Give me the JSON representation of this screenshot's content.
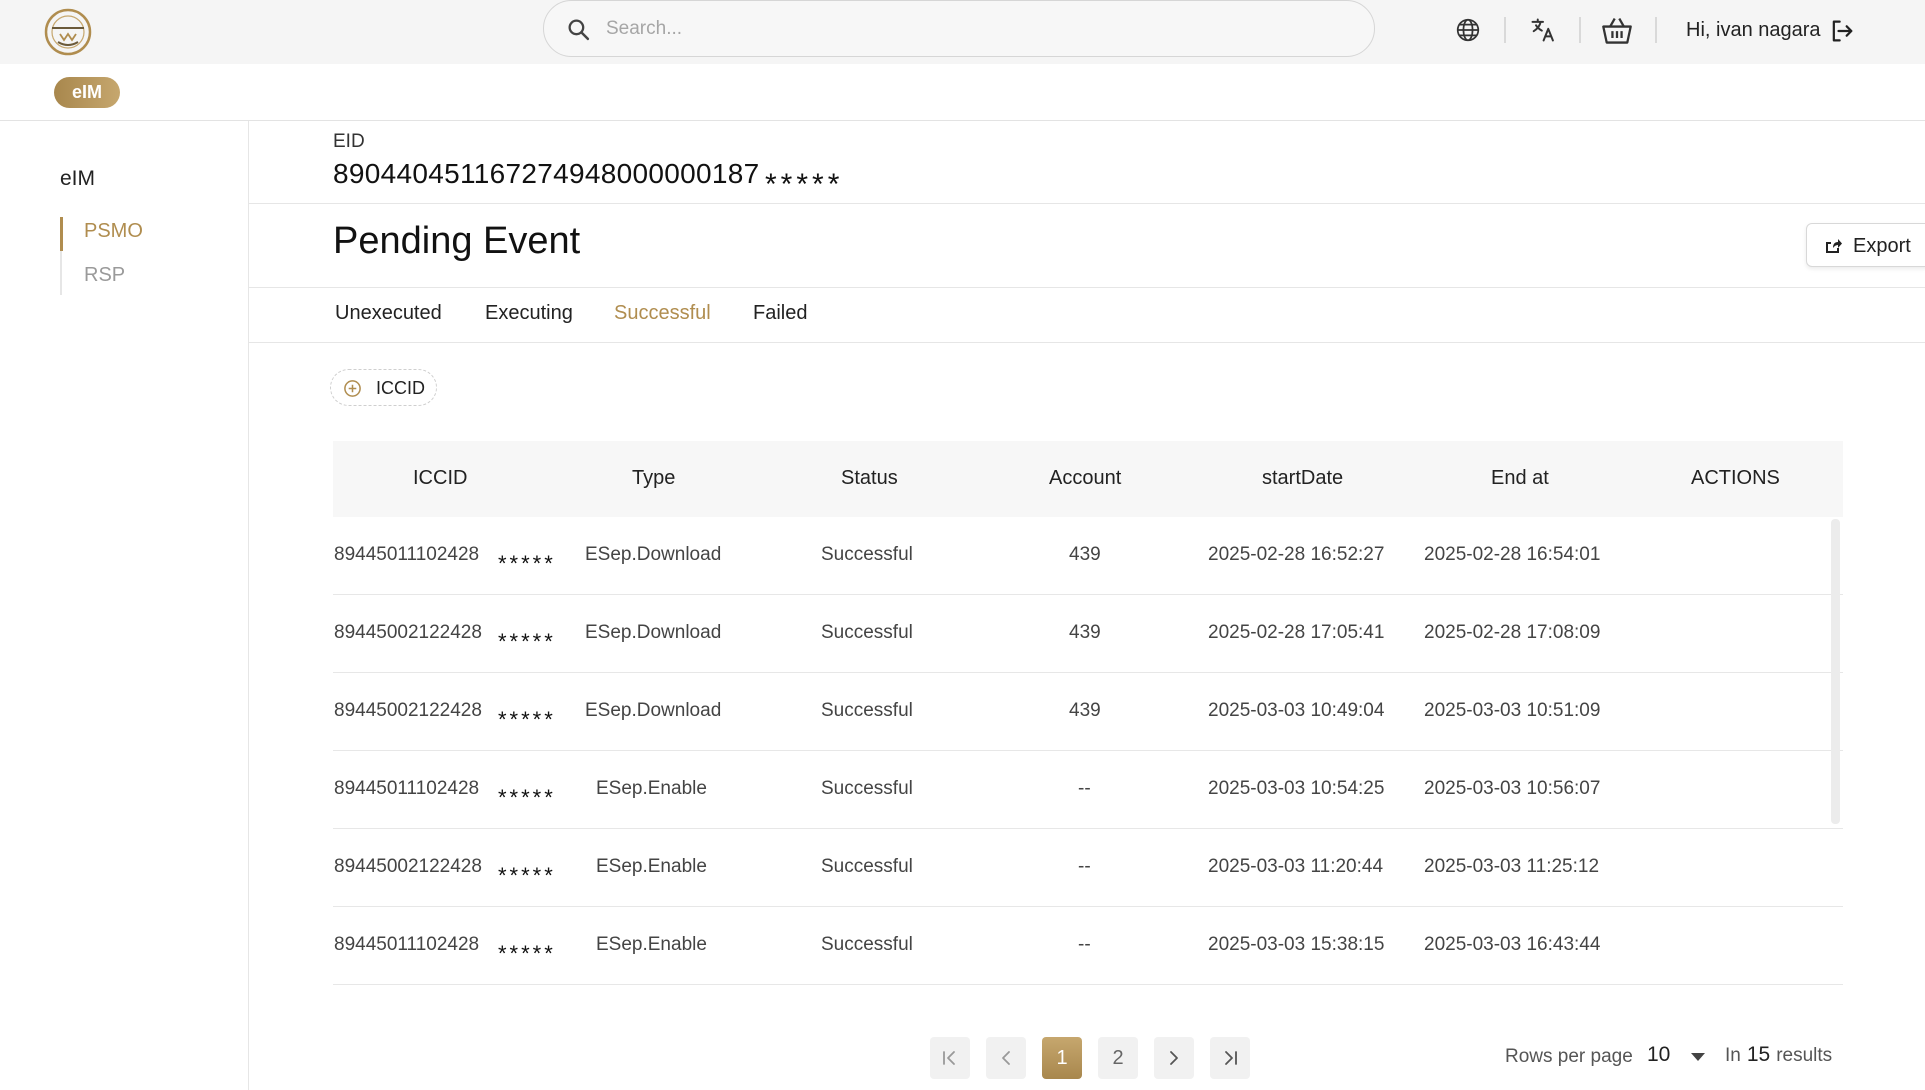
{
  "header": {
    "search_placeholder": "Search...",
    "greeting": "Hi, ivan nagara",
    "icons": [
      "globe-icon",
      "translate-icon",
      "basket-icon",
      "logout-icon"
    ]
  },
  "subbar": {
    "pill_label": "eIM"
  },
  "sidebar": {
    "title": "eIM",
    "items": [
      {
        "label": "PSMO",
        "active": true
      },
      {
        "label": "RSP",
        "active": false
      }
    ]
  },
  "main": {
    "eid_label": "EID",
    "eid_value": "890440451167274948000000187",
    "eid_mask": "*****",
    "title": "Pending Event",
    "export_label": "Export",
    "tabs": [
      {
        "label": "Unexecuted",
        "active": false
      },
      {
        "label": "Executing",
        "active": false
      },
      {
        "label": "Successful",
        "active": true
      },
      {
        "label": "Failed",
        "active": false
      }
    ],
    "filter_label": "ICCID"
  },
  "table": {
    "columns": [
      "ICCID",
      "Type",
      "Status",
      "Account",
      "startDate",
      "End at",
      "ACTIONS"
    ],
    "rows": [
      {
        "iccid": "89445011102428",
        "mask": "*****",
        "type": "ESep.Download",
        "status": "Successful",
        "account": "439",
        "start": "2025-02-28 16:52:27",
        "end": "2025-02-28 16:54:01"
      },
      {
        "iccid": "89445002122428",
        "mask": "*****",
        "type": "ESep.Download",
        "status": "Successful",
        "account": "439",
        "start": "2025-02-28 17:05:41",
        "end": "2025-02-28 17:08:09"
      },
      {
        "iccid": "89445002122428",
        "mask": "*****",
        "type": "ESep.Download",
        "status": "Successful",
        "account": "439",
        "start": "2025-03-03 10:49:04",
        "end": "2025-03-03 10:51:09"
      },
      {
        "iccid": "89445011102428",
        "mask": "*****",
        "type": "ESep.Enable",
        "status": "Successful",
        "account": "--",
        "start": "2025-03-03 10:54:25",
        "end": "2025-03-03 10:56:07"
      },
      {
        "iccid": "89445002122428",
        "mask": "*****",
        "type": "ESep.Enable",
        "status": "Successful",
        "account": "--",
        "start": "2025-03-03 11:20:44",
        "end": "2025-03-03 11:25:12"
      },
      {
        "iccid": "89445011102428",
        "mask": "*****",
        "type": "ESep.Enable",
        "status": "Successful",
        "account": "--",
        "start": "2025-03-03 15:38:15",
        "end": "2025-03-03 16:43:44"
      }
    ]
  },
  "pagination": {
    "pages": [
      "1",
      "2"
    ],
    "current_page": "1",
    "rows_per_page_label": "Rows per page",
    "rows_per_page": "10",
    "results_prefix": "In",
    "results_count": "15",
    "results_suffix": "results"
  },
  "colors": {
    "accent": "#b08d4f",
    "accent_light": "#c6a76e",
    "header_bg": "#f5f5f5"
  }
}
